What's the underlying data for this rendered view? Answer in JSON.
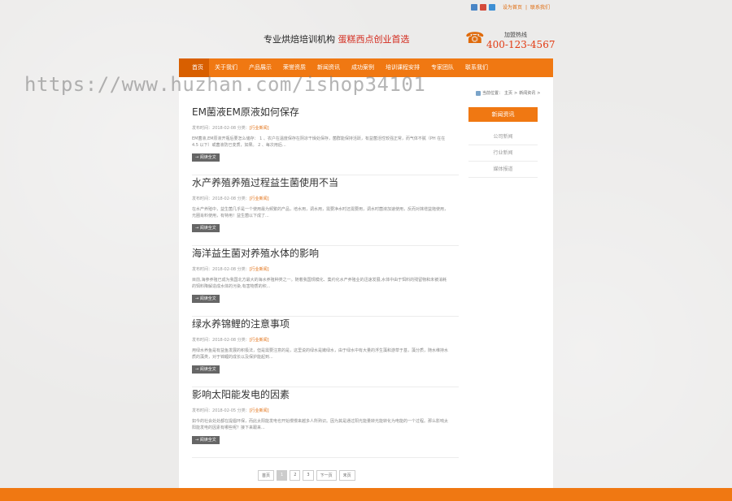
{
  "topbar": {
    "icons": [
      {
        "name": "plus-icon",
        "color": "#4a86c6"
      },
      {
        "name": "weibo-icon",
        "color": "#d44a3a"
      },
      {
        "name": "qq-icon",
        "color": "#3d8fd4"
      }
    ],
    "links": [
      "设为首页",
      "联系我们"
    ],
    "separator": "|"
  },
  "header": {
    "slogan_black": "专业烘焙培训机构",
    "slogan_red": "蛋糕西点创业首选",
    "hotline_label": "加盟热线",
    "hotline_number": "400-123-4567"
  },
  "nav": {
    "items": [
      "首页",
      "关于我们",
      "产品展示",
      "荣誉资质",
      "新闻资讯",
      "成功案例",
      "培训课程安排",
      "专家团队",
      "联系我们"
    ]
  },
  "watermark": "https://www.huzhan.com/ishop34101",
  "breadcrumb": {
    "prefix": "当前位置：",
    "home": "主页",
    "sep": ">",
    "current": "新闻资讯"
  },
  "sidebar": {
    "title": "新闻资讯",
    "items": [
      "公司新闻",
      "行业新闻",
      "媒体报道"
    ]
  },
  "articles": [
    {
      "title": "EM菌液EM原液如何保存",
      "date_label": "发布时间：",
      "date": "2018-02-08",
      "cat_label": "分类：",
      "category": "[行业新闻]",
      "desc": "EM菌液,EM原液开瓶后要怎么储存： 1 、农户在温度保存在阴凉干燥处保存，菌群能保持活跃，有益菌活性较强正常，而气体不腻（PH 在在4.5 以下）或菌液防已变质，如果。 2 、每次用后...",
      "more": "→ 阅读全文"
    },
    {
      "title": "水产养殖养殖过程益生菌使用不当",
      "date_label": "发布时间：",
      "date": "2018-02-08",
      "cat_label": "分类：",
      "category": "[行业新闻]",
      "desc": "在水产养殖中，益生菌几乎是一个使用最为频繁的产品，培水用，调水用，需要净水时还需要用，调水时菌液加速使用，反而对抹增益拖使用，光圈肖料使用，有特用！益生菌以下成了...",
      "more": "→ 阅读全文"
    },
    {
      "title": "海洋益生菌对养殖水体的影响",
      "date_label": "发布时间：",
      "date": "2018-02-08",
      "cat_label": "分类：",
      "category": "[行业新闻]",
      "desc": "目前,海参养殖已成为我国北方最大的海水养殖种类之一。随着我国规模化、集约化水产养殖业的迅速发展,水体中由于饵料的残留物和未被消耗的饵料降解造成水体的污染,有害物质的积...",
      "more": "→ 阅读全文"
    },
    {
      "title": "绿水养锦鲤的注意事项",
      "date_label": "发布时间：",
      "date": "2018-02-08",
      "cat_label": "分类：",
      "category": "[行业新闻]",
      "desc": "用绿水养鱼是有益鱼发展的积极法，但是需要注意的是，这里说的绿水是嫩绿水，由于绿水中有大量的浮生藻和游草于基，藻分质，随水维持水质的藻类，对于锦鲤的成长以及保护能起到...",
      "more": "→ 阅读全文"
    },
    {
      "title": "影响太阳能发电的因素",
      "date_label": "发布时间：",
      "date": "2018-02-05",
      "cat_label": "分类：",
      "category": "[行业新闻]",
      "desc": "如今的社会处处都在提倡环保，而此太阳能发电也开始慢慢来越多人所熟识。因为其是通过阳光能量转光能转化为电能的一个过程。那么影响太阳能发电的因素有哪些呢？接下来跟来...",
      "more": "→ 阅读全文"
    }
  ],
  "pager": [
    "首页",
    "1",
    "2",
    "3",
    "下一页",
    "末页"
  ],
  "colors": {
    "accent": "#f07812",
    "accent_dark": "#d85f00",
    "red": "#d32a1d"
  }
}
